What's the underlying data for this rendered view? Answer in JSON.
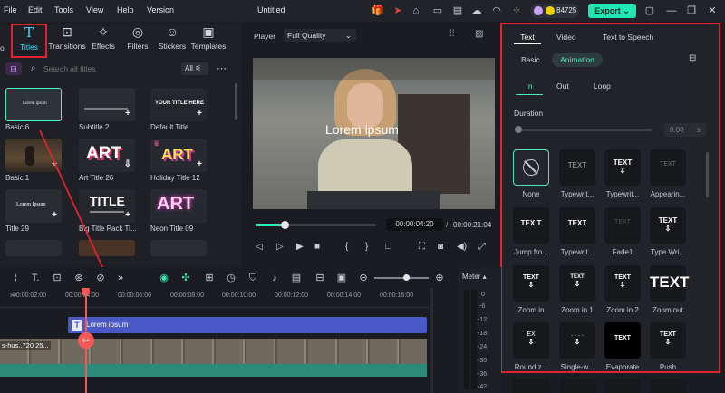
{
  "menubar": {
    "items": [
      "File",
      "Edit",
      "Tools",
      "View",
      "Help",
      "Version"
    ],
    "title": "Untitled",
    "credits": "84725",
    "export_label": "Export"
  },
  "media_tabs": [
    {
      "label": "Titles",
      "icon": "title-t-icon"
    },
    {
      "label": "Transitions",
      "icon": "transitions-icon"
    },
    {
      "label": "Effects",
      "icon": "effects-icon"
    },
    {
      "label": "Filters",
      "icon": "filters-icon"
    },
    {
      "label": "Stickers",
      "icon": "stickers-icon"
    },
    {
      "label": "Templates",
      "icon": "templates-icon"
    }
  ],
  "media_tab_partial": "o",
  "search": {
    "placeholder": "Search all titles",
    "filter_label": "All"
  },
  "titles_grid": [
    {
      "label": "Basic 6",
      "thumb": "Lorem ipsum",
      "selected": true
    },
    {
      "label": "Subtitle 2",
      "thumb": ""
    },
    {
      "label": "Default Title",
      "thumb": "YOUR TITLE HERE"
    },
    {
      "label": "Basic 1",
      "thumb": ""
    },
    {
      "label": "Art Title 26",
      "thumb": "ART"
    },
    {
      "label": "Holiday Title 12",
      "thumb": "ART"
    },
    {
      "label": "Title 29",
      "thumb": "Lorem Ipsum"
    },
    {
      "label": "Big Title Pack Ti...",
      "thumb": "TITLE"
    },
    {
      "label": "Neon Title 09",
      "thumb": "ART"
    }
  ],
  "player": {
    "label": "Player",
    "quality": "Full Quality",
    "overlay_text": "Lorem ipsum",
    "current_time": "00:00:04:20",
    "total_time": "00:00:21:04",
    "progress": 0.12
  },
  "right_panel": {
    "tabs": [
      "Text",
      "Video",
      "Text to Speech"
    ],
    "subtabs": [
      "Basic",
      "Animation"
    ],
    "anim_tabs": [
      "In",
      "Out",
      "Loop"
    ],
    "duration_label": "Duration",
    "duration_value": "0.00",
    "duration_unit": "s",
    "animations": [
      {
        "label": "None",
        "preview": "⃠"
      },
      {
        "label": "Typewrit...",
        "preview": "TEXT"
      },
      {
        "label": "Typewrit...",
        "preview": "TEXT"
      },
      {
        "label": "Appearin...",
        "preview": "TEXT"
      },
      {
        "label": "Jump fro...",
        "preview": "TEX T"
      },
      {
        "label": "Typewrit...",
        "preview": "TEXT"
      },
      {
        "label": "Fade1",
        "preview": "TEXT"
      },
      {
        "label": "Type Wri...",
        "preview": "TEXT"
      },
      {
        "label": "Zoom in",
        "preview": "TEXT"
      },
      {
        "label": "Zoom in 1",
        "preview": "TEXT"
      },
      {
        "label": "Zoom in 2",
        "preview": "TEXT"
      },
      {
        "label": "Zoom out",
        "preview": "TEXT"
      },
      {
        "label": "Round z...",
        "preview": "EX"
      },
      {
        "label": "Single-w...",
        "preview": ". . . ."
      },
      {
        "label": "Evaporate",
        "preview": "TEXT"
      },
      {
        "label": "Push",
        "preview": "TEXT"
      }
    ]
  },
  "timeline": {
    "ruler": [
      "00:00:02:00",
      "00:00:04:00",
      "00:00:06:00",
      "00:00:08:00",
      "00:00:10:00",
      "00:00:12:00",
      "00:00:14:00",
      "00:00:16:00"
    ],
    "text_clip": "Lorem ipsum",
    "video_clip_label": "s-hus..720 25...",
    "meter_label": "Meter",
    "meter_scale": [
      "0",
      "-6",
      "-12",
      "-18",
      "-24",
      "-30",
      "-36",
      "-42"
    ]
  },
  "colors": {
    "accent": "#1fe8b3",
    "highlight": "#e02330",
    "text_clip": "#4a59c6"
  }
}
